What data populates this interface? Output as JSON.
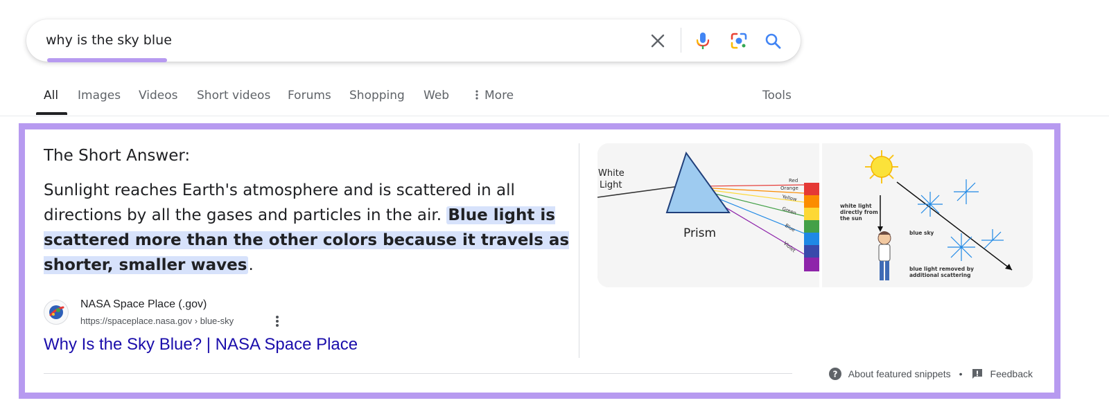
{
  "search": {
    "query": "why is the sky blue",
    "clear_icon": "close-icon",
    "voice_icon": "microphone-icon",
    "lens_icon": "camera-lens-icon",
    "search_icon": "search-icon"
  },
  "tabs": [
    {
      "label": "All",
      "active": true
    },
    {
      "label": "Images"
    },
    {
      "label": "Videos"
    },
    {
      "label": "Short videos"
    },
    {
      "label": "Forums"
    },
    {
      "label": "Shopping"
    },
    {
      "label": "Web"
    },
    {
      "label": "More",
      "icon": "vertical-dots-icon"
    }
  ],
  "tools_label": "Tools",
  "snippet": {
    "heading": "The Short Answer:",
    "answer_plain": "Sunlight reaches Earth's atmosphere and is scattered in all directions by all the gases and particles in the air. ",
    "answer_highlight": "Blue light is scattered more than the other colors because it travels as shorter, smaller waves",
    "answer_end": ".",
    "source_name": "NASA Space Place (.gov)",
    "source_url": "https://spaceplace.nasa.gov › blue-sky",
    "link_title": "Why Is the Sky Blue? | NASA Space Place",
    "image": {
      "prism_labels": {
        "white_light_line1": "White",
        "white_light_line2": "Light",
        "prism": "Prism",
        "colors": [
          "Red",
          "Orange",
          "Yellow",
          "Green",
          "Blue",
          "Violet"
        ]
      },
      "sky_labels": {
        "direct_line1": "white light",
        "direct_line2": "directly from",
        "direct_line3": "the sun",
        "blue_sky": "blue sky",
        "removed_line1": "blue light removed by",
        "removed_line2": "additional scattering"
      }
    },
    "footer": {
      "about": "About featured snippets",
      "separator": "•",
      "feedback": "Feedback"
    }
  },
  "colors": {
    "highlight_border": "#b79af0",
    "link": "#1a0dab",
    "answer_highlight_bg": "#d7e2fb"
  }
}
